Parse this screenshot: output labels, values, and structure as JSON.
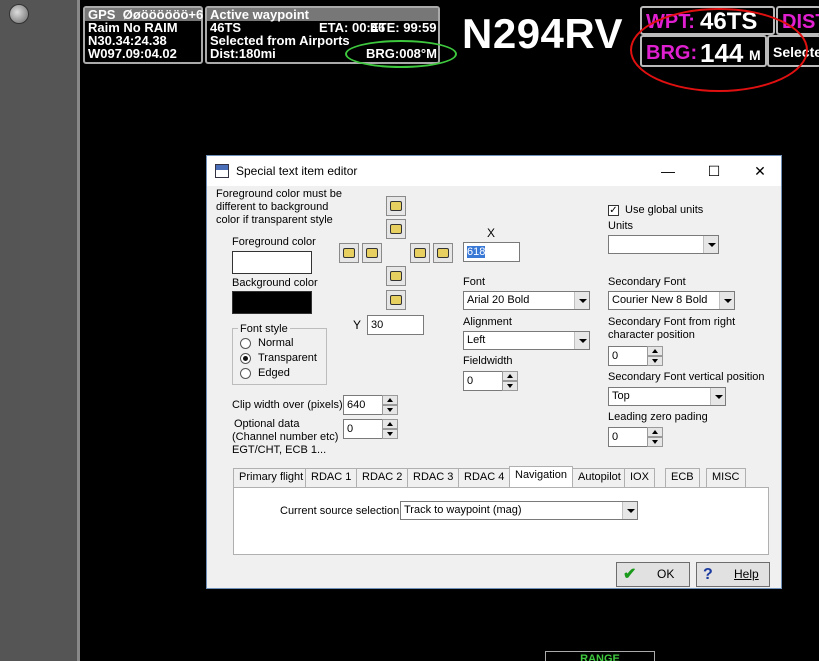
{
  "gps_box": {
    "header": "GPS",
    "header_extra": "Øøöööööö+6",
    "line1": "Raim No RAIM",
    "line2": "N30.34:24.38",
    "line3": "W097.09:04.02"
  },
  "waypoint_box": {
    "header": "Active waypoint",
    "id": "46TS",
    "eta": "ETA: 00:46",
    "ete": "ETE: 99:59",
    "source": "Selected from Airports",
    "dist": "Dist:180mi",
    "brg": "BRG:008°M"
  },
  "tail_number": "N294RV",
  "right_panel": {
    "wpt_label": "WPT:",
    "wpt_value": "46TS",
    "dist_label": "DIST",
    "brg_label": "BRG:",
    "brg_value": "144",
    "brg_unit": "M",
    "selected_text": "Selecte"
  },
  "dialog": {
    "title": "Special text item editor",
    "controls": {
      "minimize": "—",
      "maximize": "☐",
      "close": "✕"
    },
    "fg_note": [
      "Foreground color must be",
      "different to background",
      "color if transparent style"
    ],
    "fg_label": "Foreground color",
    "bg_label": "Background color",
    "font_style": {
      "legend": "Font style",
      "options": [
        "Normal",
        "Transparent",
        "Edged"
      ],
      "selected": "Transparent"
    },
    "x_label": "X",
    "x_value": "618",
    "y_label": "Y",
    "y_value": "30",
    "font_label": "Font",
    "font_value": "Arial 20 Bold",
    "alignment_label": "Alignment",
    "alignment_value": "Left",
    "fieldwidth_label": "Fieldwidth",
    "fieldwidth_value": "0",
    "use_global_units": "Use global units",
    "units_label": "Units",
    "units_value": "",
    "secondary_font_label": "Secondary Font",
    "secondary_font_value": "Courier New 8 Bold",
    "sec_font_pos_label": [
      "Secondary Font from right",
      "character position"
    ],
    "sec_font_pos_value": "0",
    "sec_font_vpos_label": "Secondary Font vertical position",
    "sec_font_vpos_value": "Top",
    "leading_zero_label": "Leading zero pading",
    "leading_zero_value": "0",
    "clip_label": "Clip width over (pixels)",
    "clip_value": "640",
    "optional_label": [
      "Optional data",
      "(Channel number etc)",
      "EGT/CHT, ECB 1..."
    ],
    "optional_value": "0",
    "tabs": [
      "Primary flight",
      "RDAC 1",
      "RDAC 2",
      "RDAC 3",
      "RDAC 4",
      "Navigation",
      "Autopilot",
      "IOX",
      "ECB",
      "MISC"
    ],
    "active_tab": "Navigation",
    "source_label": "Current source selection",
    "source_value": "Track to waypoint (mag)",
    "ok_label": "OK",
    "help_label": "Help"
  },
  "bottom_label": "RANGE",
  "colors": {
    "magenta": "#e020d0",
    "annotation_green": "#3ec83e",
    "annotation_red": "#e01010"
  }
}
